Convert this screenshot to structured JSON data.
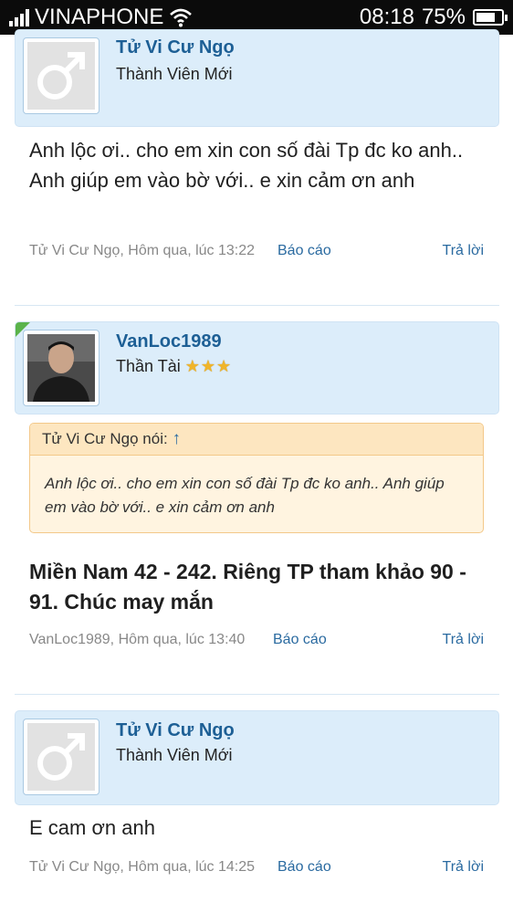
{
  "status_bar": {
    "carrier": "VINAPHONE",
    "time": "08:18",
    "battery": "75%",
    "battery_level": 0.75
  },
  "posts": [
    {
      "username": "Tử Vi Cư Ngọ",
      "user_title": "Thành Viên Mới",
      "avatar": "male-placeholder-icon",
      "message": "Anh lộc ơi.. cho em xin con số đài Tp đc ko anh.. Anh giúp em vào bờ với.. e xin cảm ơn anh",
      "meta": "Tử Vi Cư Ngọ, Hôm qua, lúc 13:22",
      "report_label": "Báo cáo",
      "reply_label": "Trả lời"
    },
    {
      "username": "VanLoc1989",
      "user_title": "Thần Tài",
      "user_stars": "★★★",
      "avatar": "user-photo",
      "quote_header": "Tử Vi Cư Ngọ nói:",
      "quote_arrow": "↑",
      "quote_text": "Anh lộc ơi.. cho em xin con số đài Tp đc ko anh.. Anh giúp em vào bờ với.. e xin cảm ơn anh",
      "message": "Miền Nam 42 - 242. Riêng TP tham khảo 90 - 91. Chúc may mắn",
      "meta": "VanLoc1989, Hôm qua, lúc 13:40",
      "report_label": "Báo cáo",
      "reply_label": "Trả lời"
    },
    {
      "username": "Tử Vi Cư Ngọ",
      "user_title": "Thành Viên Mới",
      "avatar": "male-placeholder-icon",
      "message": "E cam ơn anh",
      "meta": "Tử Vi Cư Ngọ, Hôm qua, lúc 14:25",
      "report_label": "Báo cáo",
      "reply_label": "Trả lời"
    }
  ],
  "colors": {
    "card_bg": "#dcedfa",
    "username": "#1d5f95",
    "link": "#2a6aa0",
    "quote_bg": "#fff4e0",
    "quote_border": "#f3c889"
  }
}
